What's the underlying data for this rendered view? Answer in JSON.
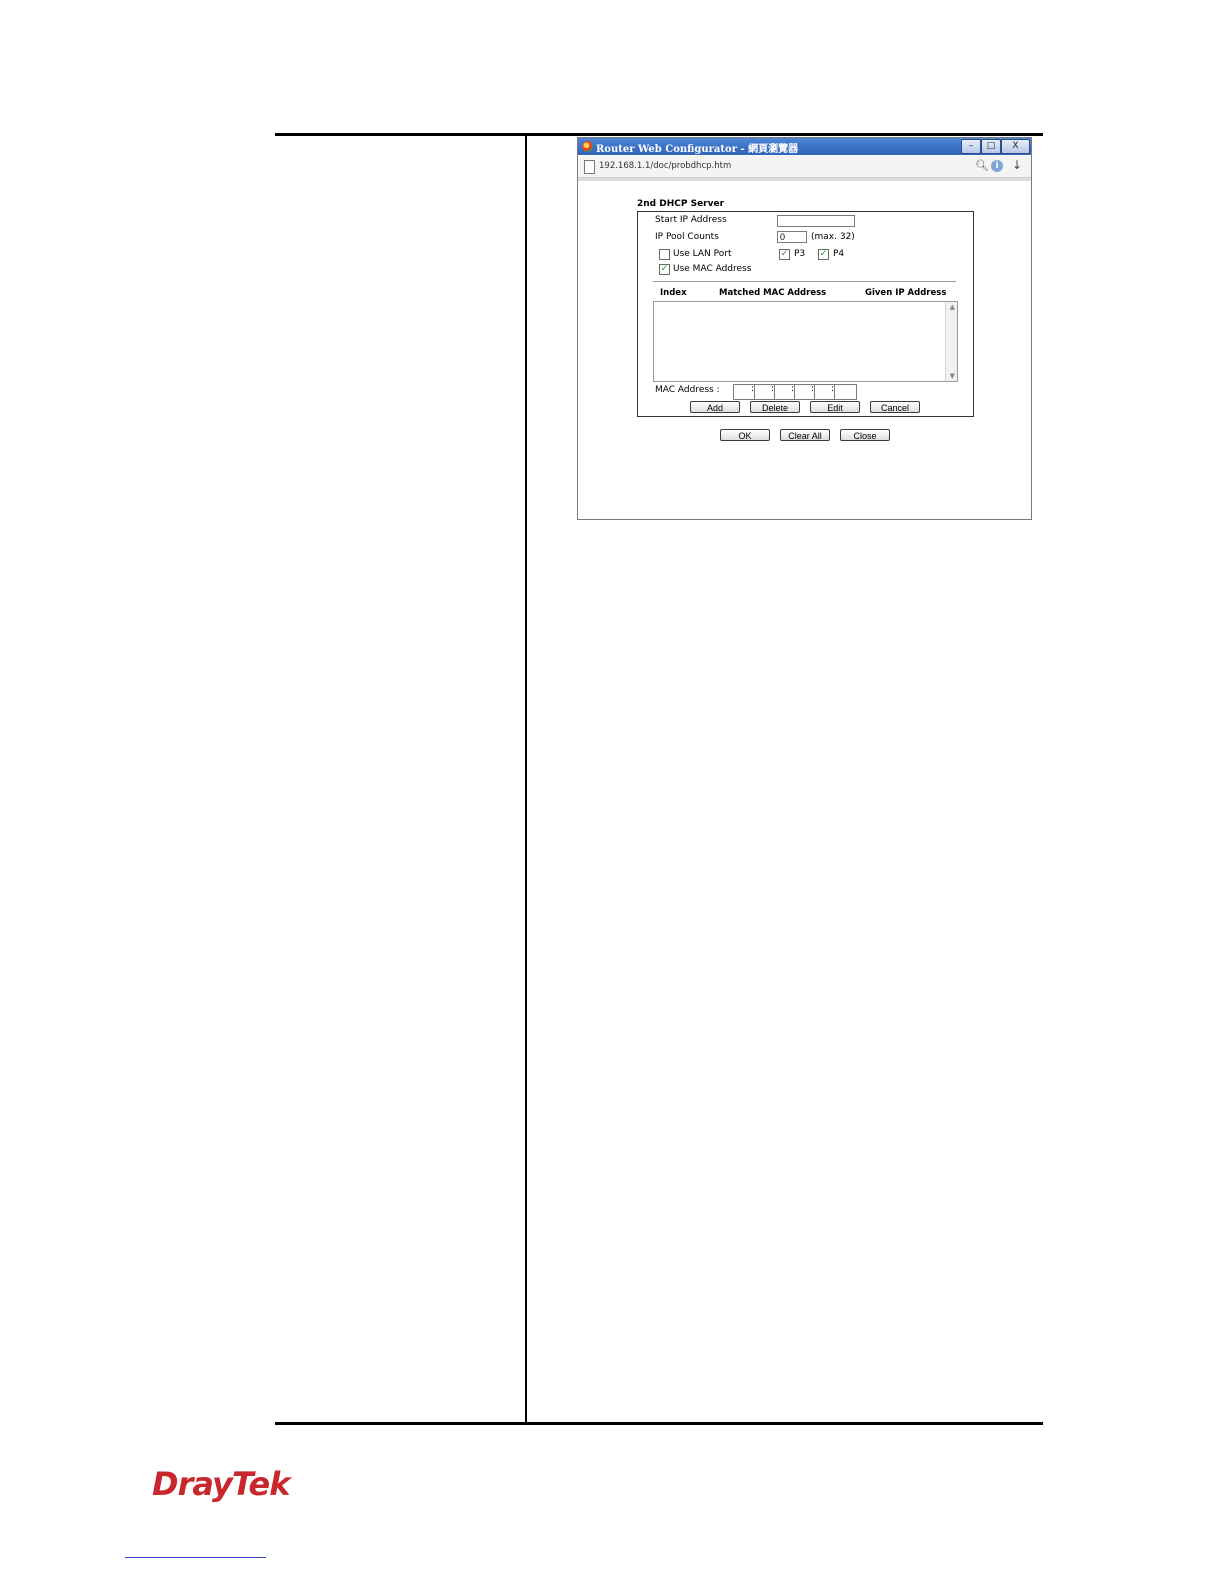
{
  "window": {
    "title": "Router Web Configurator - 網頁瀏覽器",
    "url": "192.168.1.1/doc/probdhcp.htm",
    "controls": {
      "minimize": "–",
      "maximize": "□",
      "close": "X"
    }
  },
  "form": {
    "section_title": "2nd DHCP Server",
    "start_ip": {
      "label": "Start IP Address",
      "value": ""
    },
    "ip_pool": {
      "label": "IP Pool Counts",
      "value": "0",
      "hint": "(max. 32)"
    },
    "use_lan_port": {
      "label": "Use LAN Port",
      "checked": false
    },
    "ports": [
      {
        "label": "P3",
        "checked": true
      },
      {
        "label": "P4",
        "checked": true
      }
    ],
    "use_mac": {
      "label": "Use MAC Address",
      "checked": true
    },
    "table_headers": {
      "index": "Index",
      "mac": "Matched MAC Address",
      "ip": "Given IP Address"
    },
    "mac_label": "MAC Address :",
    "row_buttons": {
      "add": "Add",
      "delete": "Delete",
      "edit": "Edit",
      "cancel": "Cancel"
    },
    "bottom_buttons": {
      "ok": "OK",
      "clear_all": "Clear All",
      "close": "Close"
    }
  },
  "footer": {
    "logo": "DrayTek"
  },
  "icons": {
    "app": "browser-app-icon",
    "page": "page-icon",
    "zoom": "zoom-icon",
    "info": "info-icon",
    "download": "download-arrow-icon",
    "check": "✓"
  },
  "colors": {
    "titlebar": "#2e63b8",
    "logo": "#c8282d"
  }
}
